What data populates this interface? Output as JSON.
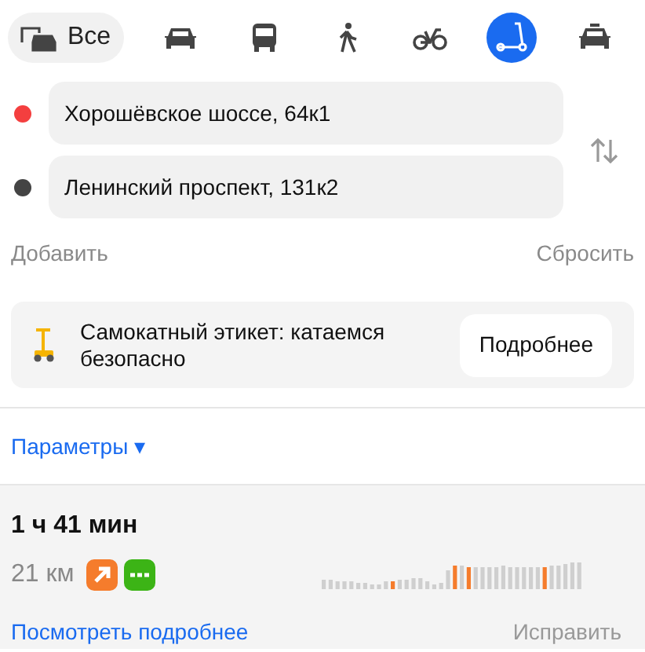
{
  "modes": [
    {
      "kind": "all",
      "label": "Все",
      "selected": false
    },
    {
      "kind": "car",
      "selected": false
    },
    {
      "kind": "bus",
      "selected": false
    },
    {
      "kind": "walk",
      "selected": false
    },
    {
      "kind": "bike",
      "selected": false
    },
    {
      "kind": "scooter",
      "selected": true
    },
    {
      "kind": "taxi",
      "selected": false
    }
  ],
  "points": [
    {
      "value": "Хорошёвское шоссе, 64к1",
      "color": "#f43f3f"
    },
    {
      "value": "Ленинский проспект, 131к2",
      "color": "#444444"
    }
  ],
  "add_link": "Добавить",
  "reset_link": "Сбросить",
  "promo": {
    "text": "Самокатный этикет: катаемся безопасно",
    "button": "Подробнее"
  },
  "params_link": "Параметры ▾",
  "route": {
    "duration": "1 ч 41 мин",
    "distance": "21 км",
    "details_link": "Посмотреть подробнее",
    "fix_link": "Исправить"
  }
}
